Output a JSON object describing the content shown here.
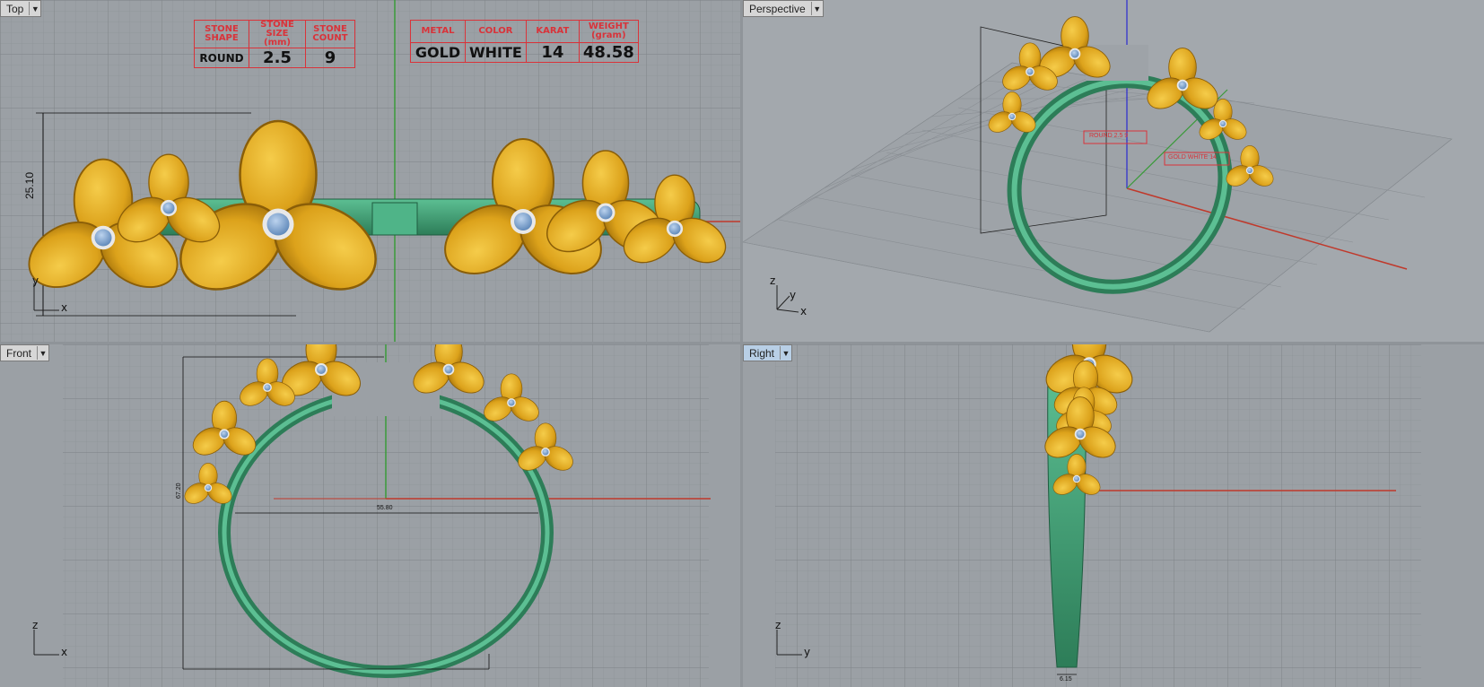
{
  "viewports": {
    "top": {
      "label": "Top",
      "axis_y": "y",
      "axis_x": "x",
      "dimension": "25.10"
    },
    "perspective": {
      "label": "Perspective",
      "axis_z": "z",
      "axis_y": "y",
      "axis_x": "x",
      "callout_1": "ROUND 2.5 9",
      "callout_2": "GOLD WHITE 14"
    },
    "front": {
      "label": "Front",
      "axis_z": "z",
      "axis_x": "x",
      "dim_height": "67.20",
      "dim_width": "55.80"
    },
    "right": {
      "label": "Right",
      "axis_z": "z",
      "axis_y": "y",
      "dim_width": "6.15"
    }
  },
  "stone_table": {
    "headers": [
      "STONE SHAPE",
      "STONE SIZE (mm)",
      "STONE COUNT"
    ],
    "values": [
      "ROUND",
      "2.5",
      "9"
    ]
  },
  "metal_table": {
    "headers": [
      "METAL",
      "COLOR",
      "KARAT",
      "WEIGHT (gram)"
    ],
    "values": [
      "GOLD",
      "WHITE",
      "14",
      "48.58"
    ]
  },
  "colors": {
    "gold": "#e0a91e",
    "green": "#3f9a72",
    "grid_bg": "#9ba0a5",
    "red_axis": "#c0392b",
    "green_axis": "#3a9a3a",
    "spec_red": "#d9333a"
  }
}
